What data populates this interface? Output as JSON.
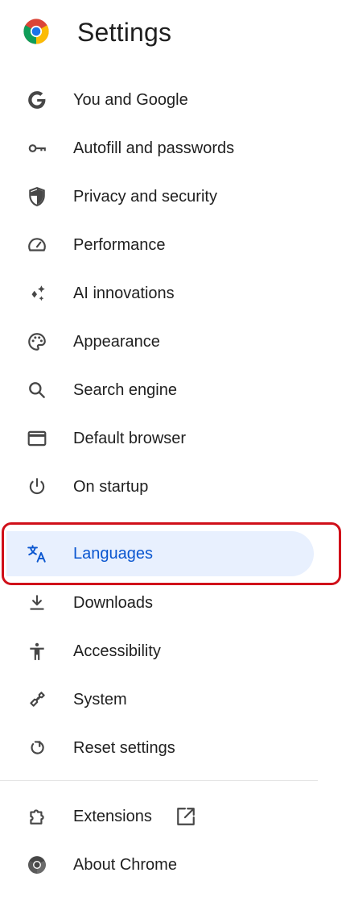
{
  "header": {
    "title": "Settings",
    "logo_icon": "chrome-logo-icon"
  },
  "nav": {
    "items": [
      {
        "label": "You and Google",
        "icon": "google-g-icon"
      },
      {
        "label": "Autofill and passwords",
        "icon": "key-icon"
      },
      {
        "label": "Privacy and security",
        "icon": "shield-icon"
      },
      {
        "label": "Performance",
        "icon": "speedometer-icon"
      },
      {
        "label": "AI innovations",
        "icon": "sparkle-icon"
      },
      {
        "label": "Appearance",
        "icon": "palette-icon"
      },
      {
        "label": "Search engine",
        "icon": "search-icon"
      },
      {
        "label": "Default browser",
        "icon": "browser-window-icon"
      },
      {
        "label": "On startup",
        "icon": "power-icon"
      },
      {
        "label": "Languages",
        "icon": "translate-icon",
        "selected": true
      },
      {
        "label": "Downloads",
        "icon": "download-icon"
      },
      {
        "label": "Accessibility",
        "icon": "accessibility-icon"
      },
      {
        "label": "System",
        "icon": "wrench-icon"
      },
      {
        "label": "Reset settings",
        "icon": "reset-icon"
      }
    ],
    "extra": [
      {
        "label": "Extensions",
        "icon": "extension-puzzle-icon",
        "trailing_icon": "open-in-new-icon"
      },
      {
        "label": "About Chrome",
        "icon": "chrome-logo-icon"
      }
    ]
  },
  "colors": {
    "selected_bg": "#e8f0fe",
    "selected_text": "#0b57d0",
    "highlight_border": "#d0101a",
    "icon_gray": "#474747"
  }
}
